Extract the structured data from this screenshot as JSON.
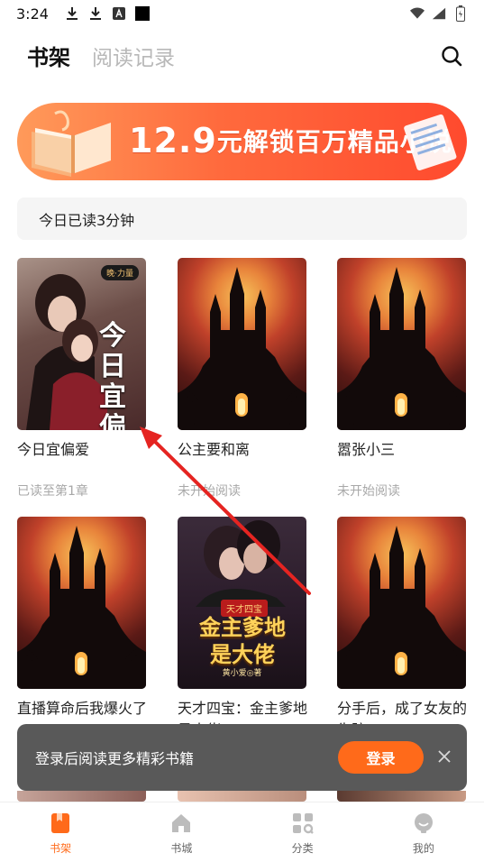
{
  "status_bar": {
    "time": "3:24"
  },
  "header": {
    "tabs": [
      {
        "label": "书架",
        "active": true
      },
      {
        "label": "阅读记录",
        "active": false
      }
    ]
  },
  "banner": {
    "price": "12.9",
    "text": "元解锁百万精品小说"
  },
  "reading_time": "今日已读3分钟",
  "books": [
    {
      "title": "今日宜偏爱",
      "status": "已读至第1章",
      "cover": "romance",
      "cover_badge": "晚·力量",
      "cover_title": "今日宜偏爱"
    },
    {
      "title": "公主要和离",
      "status": "未开始阅读",
      "cover": "castle"
    },
    {
      "title": "嚣张小三",
      "status": "未开始阅读",
      "cover": "castle"
    },
    {
      "title": "直播算命后我爆火了",
      "cover": "castle"
    },
    {
      "title": "天才四宝：金主爹地是大佬",
      "cover": "ceo",
      "cover_tag": "天才四宝",
      "cover_title": "金主爹地是大佬",
      "cover_author": "黄小爱◎著"
    },
    {
      "title": "分手后，成了女友的失踪",
      "cover": "castle"
    }
  ],
  "toast": {
    "message": "登录后阅读更多精彩书籍",
    "login_label": "登录"
  },
  "bottom_nav": [
    {
      "label": "书架",
      "active": true
    },
    {
      "label": "书城",
      "active": false
    },
    {
      "label": "分类",
      "active": false
    },
    {
      "label": "我的",
      "active": false
    }
  ],
  "colors": {
    "accent": "#ff6a1a",
    "annotation": "#e52421"
  }
}
